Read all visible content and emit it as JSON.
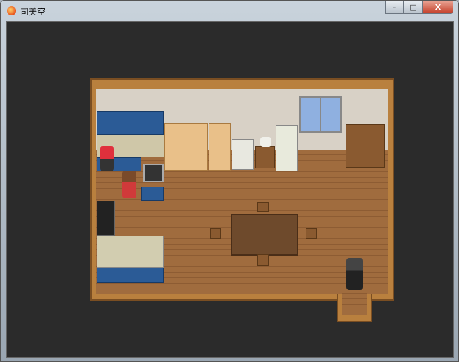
{
  "window": {
    "title": "司美空",
    "minimize_icon": "minimize-icon",
    "maximize_icon": "maximize-icon",
    "close_icon": "close-icon"
  },
  "controls": {
    "minimize": "–",
    "maximize": "□",
    "close": "X"
  },
  "scene": {
    "type": "rpg-map-kitchen-dining-room",
    "colors": {
      "floor": "#a06c3e",
      "wall": "#d8d1c6",
      "cabinets": "#2b5b96",
      "background": "#2b2b2b"
    }
  }
}
